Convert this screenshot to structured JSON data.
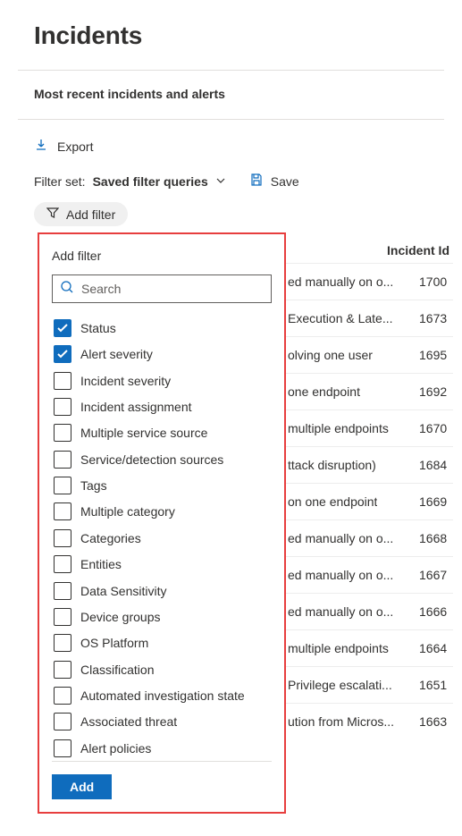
{
  "header": {
    "title": "Incidents",
    "subhead": "Most recent incidents and alerts"
  },
  "toolbar": {
    "export_label": "Export",
    "filter_set_label": "Filter set:",
    "filter_set_value": "Saved filter queries",
    "save_label": "Save",
    "add_filter_label": "Add filter"
  },
  "popup": {
    "title": "Add filter",
    "search_placeholder": "Search",
    "add_button": "Add",
    "options": [
      {
        "label": "Status",
        "checked": true
      },
      {
        "label": "Alert severity",
        "checked": true
      },
      {
        "label": "Incident severity",
        "checked": false
      },
      {
        "label": "Incident assignment",
        "checked": false
      },
      {
        "label": "Multiple service source",
        "checked": false
      },
      {
        "label": "Service/detection sources",
        "checked": false
      },
      {
        "label": "Tags",
        "checked": false
      },
      {
        "label": "Multiple category",
        "checked": false
      },
      {
        "label": "Categories",
        "checked": false
      },
      {
        "label": "Entities",
        "checked": false
      },
      {
        "label": "Data Sensitivity",
        "checked": false
      },
      {
        "label": "Device groups",
        "checked": false
      },
      {
        "label": "OS Platform",
        "checked": false
      },
      {
        "label": "Classification",
        "checked": false
      },
      {
        "label": "Automated investigation state",
        "checked": false
      },
      {
        "label": "Associated threat",
        "checked": false
      },
      {
        "label": "Alert policies",
        "checked": false
      }
    ]
  },
  "table": {
    "cols": {
      "id": "Incident Id"
    },
    "rows": [
      {
        "name": "ed manually on o...",
        "id": "1700"
      },
      {
        "name": "Execution & Late...",
        "id": "1673"
      },
      {
        "name": "olving one user",
        "id": "1695"
      },
      {
        "name": "one endpoint",
        "id": "1692"
      },
      {
        "name": "multiple endpoints",
        "id": "1670"
      },
      {
        "name": "ttack disruption)",
        "id": "1684"
      },
      {
        "name": "on one endpoint",
        "id": "1669"
      },
      {
        "name": "ed manually on o...",
        "id": "1668"
      },
      {
        "name": "ed manually on o...",
        "id": "1667"
      },
      {
        "name": "ed manually on o...",
        "id": "1666"
      },
      {
        "name": "multiple endpoints",
        "id": "1664"
      },
      {
        "name": "Privilege escalati...",
        "id": "1651"
      },
      {
        "name": "ution from Micros...",
        "id": "1663"
      }
    ]
  }
}
